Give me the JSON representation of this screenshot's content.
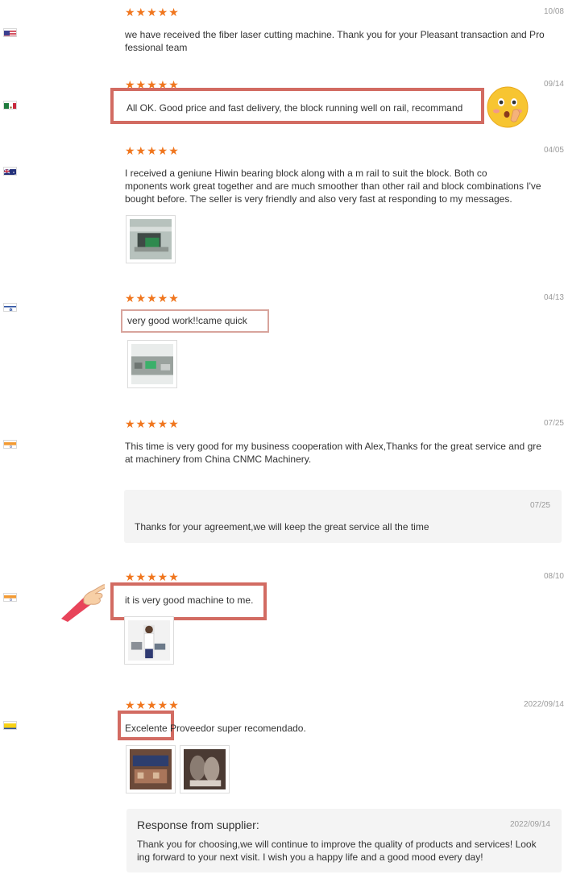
{
  "reviews": [
    {
      "country": "United States",
      "stars": "★★★★★",
      "date": "10/08",
      "text_lines": [
        "we have received the fiber laser cutting machine. Thank you for your Pleasant transaction and Pro",
        "fessional team"
      ]
    },
    {
      "country": "Mexico",
      "stars": "★★★★★",
      "date": "09/14",
      "text": "All OK. Good price and fast delivery, the block running well on rail, recommand"
    },
    {
      "country": "Australia",
      "stars": "★★★★★",
      "date": "04/05",
      "text_lines": [
        "I received a geniune Hiwin bearing block along with a m rail to suit the block. Both co",
        "mponents work great together and are much smoother than other rail and block combinations I've",
        "bought before. The seller is very friendly and also very fast at responding to my messages."
      ]
    },
    {
      "country": "Israel",
      "stars": "★★★★★",
      "date": "04/13",
      "text": "very good work!!came quick"
    },
    {
      "country": "India",
      "stars": "★★★★★",
      "date": "07/25",
      "text_lines": [
        "This time is very good for my business cooperation with Alex,Thanks for the great service and gre",
        "at machinery from China CNMC Machinery."
      ],
      "reply": {
        "date": "07/25",
        "text": "Thanks for your agreement,we will keep the great service all the time"
      }
    },
    {
      "country": "India",
      "stars": "★★★★★",
      "date": "08/10",
      "text": "it is very good machine to me."
    },
    {
      "country": "Colombia",
      "stars": "★★★★★",
      "date": "2022/09/14",
      "text_highlight": "Excelente",
      "text_rest": " Proveedor super recomendado.",
      "reply": {
        "title": "Response from supplier:",
        "date": "2022/09/14",
        "text_lines": [
          "Thank you for choosing,we will continue to improve the quality of products and services! Look",
          "ing forward to your next visit. I wish you a happy life and a good mood every day!"
        ]
      }
    }
  ],
  "colors": {
    "star": "#f0761e",
    "highlight_box": "#d26b62",
    "reply_bg": "#f4f4f4"
  },
  "icons": [
    "surprised-emoji-icon",
    "pointing-hand-icon"
  ]
}
